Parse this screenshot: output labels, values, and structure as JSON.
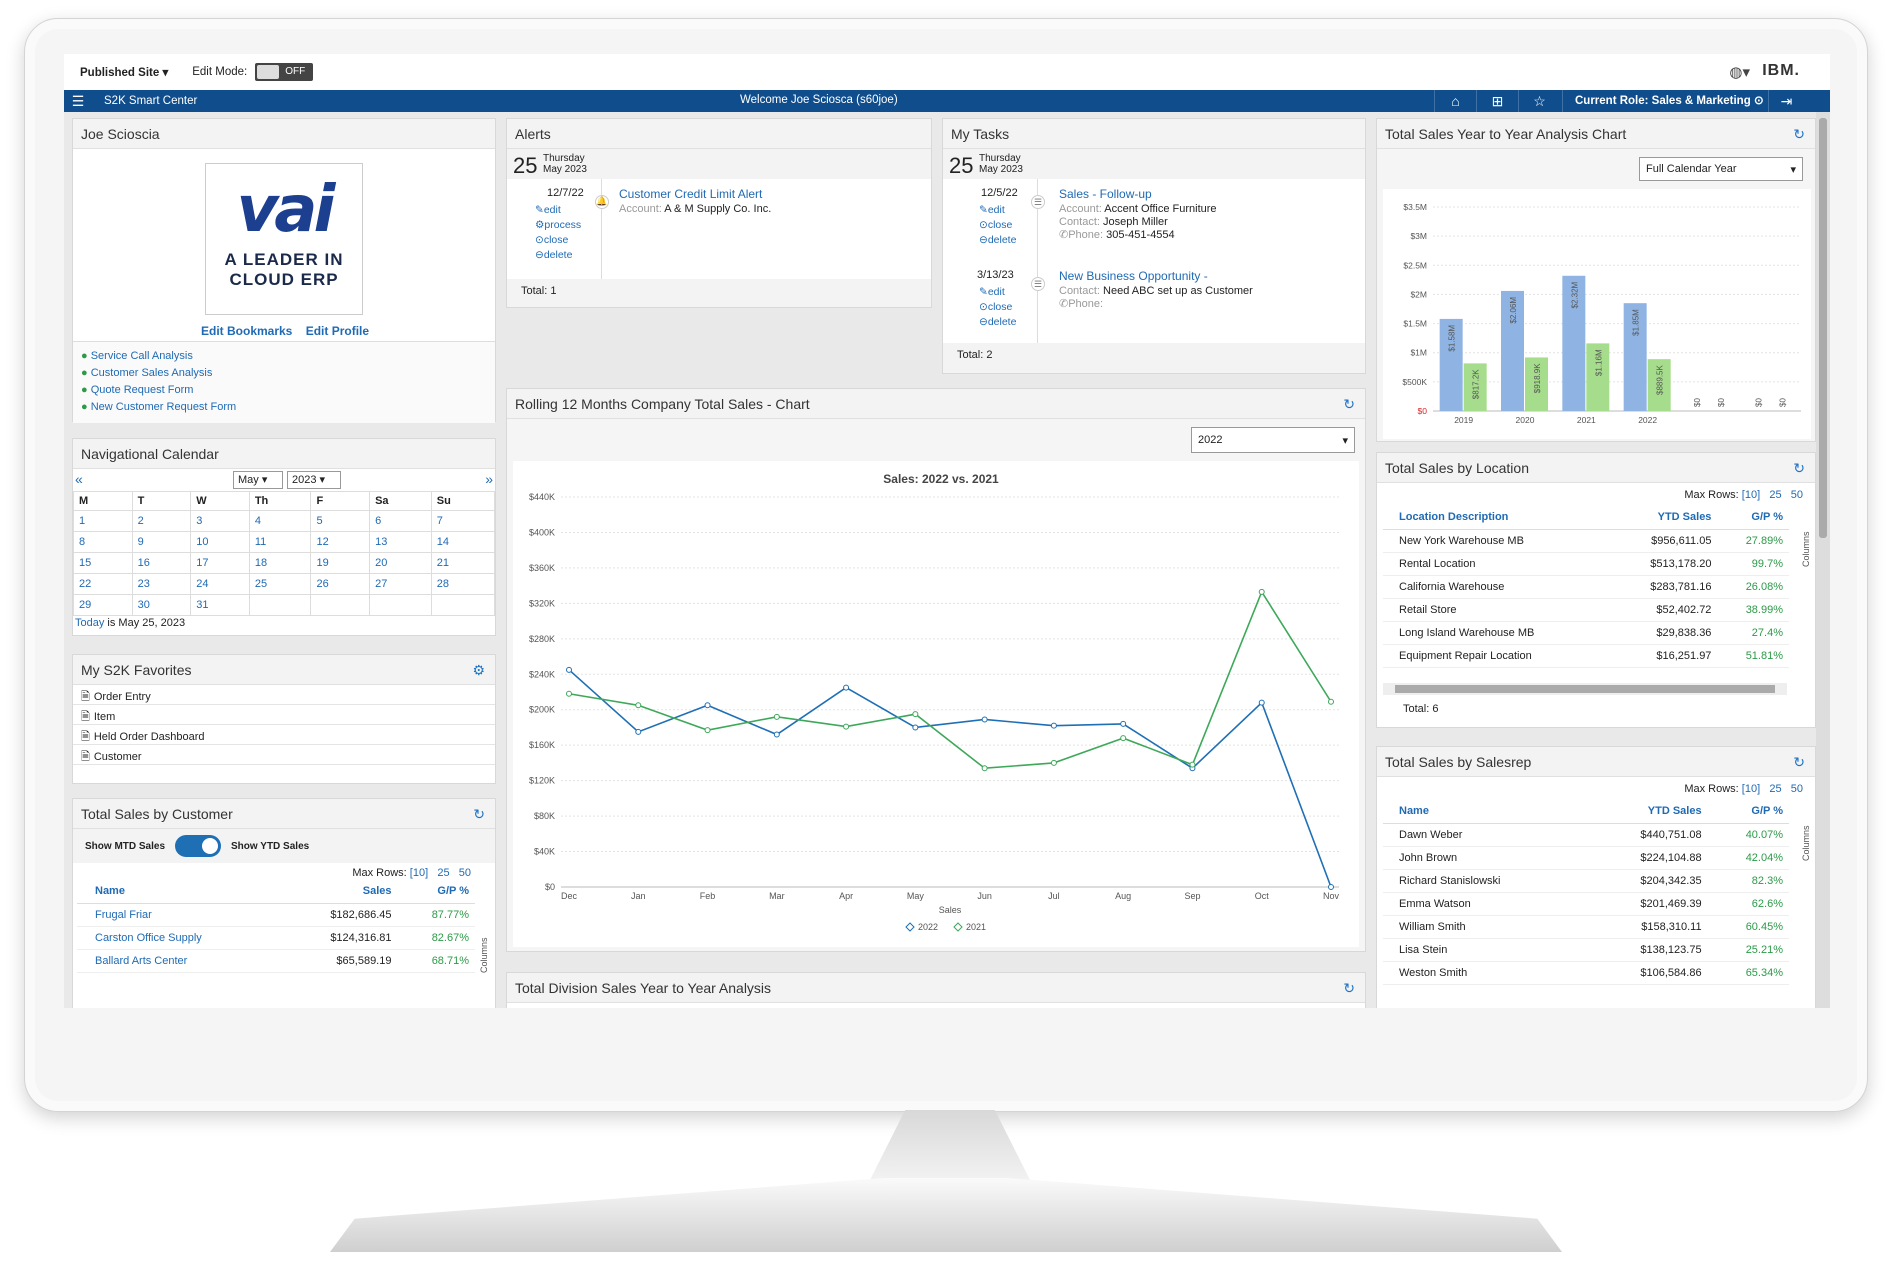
{
  "topbar": {
    "site": "Published Site",
    "edit_mode_label": "Edit Mode:",
    "edit_mode_value": "OFF",
    "brand": "IBM."
  },
  "navbar": {
    "app_title": "S2K Smart Center",
    "welcome": "Welcome Joe Sciosca (s60joe)",
    "role": "Current Role: Sales & Marketing"
  },
  "profile": {
    "name": "Joe Scioscia",
    "logo_text": "vai",
    "logo_tagline_1": "A LEADER IN",
    "logo_tagline_2": "CLOUD ERP",
    "edit_bookmarks": "Edit Bookmarks",
    "edit_profile": "Edit Profile",
    "links": [
      "Service Call Analysis",
      "Customer Sales Analysis",
      "Quote Request Form",
      "New Customer Request Form"
    ]
  },
  "calendar": {
    "title": "Navigational Calendar",
    "month": "May",
    "year": "2023",
    "prev": "«",
    "next": "»",
    "days": [
      "M",
      "T",
      "W",
      "Th",
      "F",
      "Sa",
      "Su"
    ],
    "weeks": [
      [
        "1",
        "2",
        "3",
        "4",
        "5",
        "6",
        "7"
      ],
      [
        "8",
        "9",
        "10",
        "11",
        "12",
        "13",
        "14"
      ],
      [
        "15",
        "16",
        "17",
        "18",
        "19",
        "20",
        "21"
      ],
      [
        "22",
        "23",
        "24",
        "25",
        "26",
        "27",
        "28"
      ],
      [
        "29",
        "30",
        "31",
        "",
        "",
        "",
        ""
      ]
    ],
    "today_link": "Today",
    "today_text": " is May 25, 2023"
  },
  "favorites": {
    "title": "My S2K Favorites",
    "items": [
      "Order Entry",
      "Item",
      "Held Order Dashboard",
      "Customer"
    ]
  },
  "sales_by_customer": {
    "title": "Total Sales by Customer",
    "mtd_label": "Show MTD Sales",
    "ytd_label": "Show YTD Sales",
    "max_rows_label": "Max Rows:",
    "max_rows": [
      "[10]",
      "25",
      "50"
    ],
    "columns_label": "Columns",
    "headers": [
      "Name",
      "Sales",
      "G/P %"
    ],
    "rows": [
      [
        "Frugal Friar",
        "$182,686.45",
        "87.77%"
      ],
      [
        "Carston Office Supply",
        "$124,316.81",
        "82.67%"
      ],
      [
        "Ballard Arts Center",
        "$65,589.19",
        "68.71%"
      ]
    ]
  },
  "alerts": {
    "title": "Alerts",
    "day": "25",
    "weekday": "Thursday",
    "month_year": "May 2023",
    "item": {
      "date": "12/7/22",
      "actions": [
        "edit",
        "process",
        "close",
        "delete"
      ],
      "title": "Customer Credit Limit Alert",
      "account_label": "Account:",
      "account": "A & M Supply Co. Inc."
    },
    "total": "Total: 1"
  },
  "tasks": {
    "title": "My Tasks",
    "day": "25",
    "weekday": "Thursday",
    "month_year": "May 2023",
    "items": [
      {
        "date": "12/5/22",
        "actions": [
          "edit",
          "close",
          "delete"
        ],
        "title": "Sales - Follow-up",
        "account_label": "Account:",
        "account": "Accent Office Furniture",
        "contact_label": "Contact:",
        "contact": "Joseph Miller",
        "phone_label": "Phone:",
        "phone": "305-451-4554"
      },
      {
        "date": "3/13/23",
        "actions": [
          "edit",
          "close",
          "delete"
        ],
        "title": "New Business Opportunity -",
        "contact_label": "Contact:",
        "contact": "Need ABC set up as Customer",
        "phone_label": "Phone:",
        "phone": ""
      }
    ],
    "total": "Total: 2"
  },
  "rolling_chart": {
    "title": "Rolling 12 Months Company Total Sales - Chart",
    "year_select": "2022",
    "chart_title": "Sales: 2022 vs. 2021"
  },
  "division_panel": {
    "title": "Total Division Sales Year to Year Analysis"
  },
  "yoy_chart": {
    "title": "Total Sales Year to Year Analysis Chart",
    "select": "Full Calendar Year"
  },
  "sales_by_location": {
    "title": "Total Sales by Location",
    "max_rows_label": "Max Rows:",
    "max_rows": [
      "[10]",
      "25",
      "50"
    ],
    "columns_label": "Columns",
    "headers": [
      "Location Description",
      "YTD Sales",
      "G/P %"
    ],
    "rows": [
      [
        "New York Warehouse MB",
        "$956,611.05",
        "27.89%"
      ],
      [
        "Rental Location",
        "$513,178.20",
        "99.7%"
      ],
      [
        "California Warehouse",
        "$283,781.16",
        "26.08%"
      ],
      [
        "Retail Store",
        "$52,402.72",
        "38.99%"
      ],
      [
        "Long Island Warehouse MB",
        "$29,838.36",
        "27.4%"
      ],
      [
        "Equipment Repair Location",
        "$16,251.97",
        "51.81%"
      ]
    ],
    "total": "Total: 6"
  },
  "sales_by_salesrep": {
    "title": "Total Sales by Salesrep",
    "max_rows_label": "Max Rows:",
    "max_rows": [
      "[10]",
      "25",
      "50"
    ],
    "columns_label": "Columns",
    "headers": [
      "Name",
      "YTD Sales",
      "G/P %"
    ],
    "rows": [
      [
        "Dawn Weber",
        "$440,751.08",
        "40.07%"
      ],
      [
        "John Brown",
        "$224,104.88",
        "42.04%"
      ],
      [
        "Richard Stanislowski",
        "$204,342.35",
        "82.3%"
      ],
      [
        "Emma Watson",
        "$201,469.39",
        "62.6%"
      ],
      [
        "William Smith",
        "$158,310.11",
        "60.45%"
      ],
      [
        "Lisa Stein",
        "$138,123.75",
        "25.21%"
      ],
      [
        "Weston Smith",
        "$106,584.86",
        "65.34%"
      ]
    ]
  },
  "colors": {
    "nav": "#0f4d8c",
    "series_2022": "#1f6fb5",
    "series_2021": "#3ea85a",
    "bar_blue": "#8fb4e3",
    "bar_green": "#a6dd8c"
  },
  "chart_data": [
    {
      "type": "line",
      "title": "Sales: 2022 vs. 2021",
      "xlabel": "Sales",
      "ylabel": "",
      "categories": [
        "Dec",
        "Jan",
        "Feb",
        "Mar",
        "Apr",
        "May",
        "Jun",
        "Jul",
        "Aug",
        "Sep",
        "Oct",
        "Nov"
      ],
      "y_ticks": [
        "$0",
        "$40K",
        "$80K",
        "$120K",
        "$160K",
        "$200K",
        "$240K",
        "$280K",
        "$320K",
        "$360K",
        "$400K",
        "$440K"
      ],
      "ylim": [
        0,
        440000
      ],
      "grid": true,
      "legend": "bottom",
      "series": [
        {
          "name": "2022",
          "values": [
            245000,
            175000,
            205000,
            172000,
            225000,
            180000,
            189000,
            182000,
            184000,
            134000,
            208000,
            0
          ]
        },
        {
          "name": "2021",
          "values": [
            218000,
            205000,
            177000,
            192000,
            181000,
            195000,
            134000,
            140000,
            168000,
            138000,
            333000,
            209000
          ]
        }
      ]
    },
    {
      "type": "bar",
      "title": "",
      "categories": [
        "2019",
        "2020",
        "2021",
        "2022",
        "",
        ""
      ],
      "y_ticks": [
        "$0",
        "$500K",
        "$1M",
        "$1.5M",
        "$2M",
        "$2.5M",
        "$3M",
        "$3.5M"
      ],
      "ylim": [
        0,
        3500000
      ],
      "grid": true,
      "series": [
        {
          "values": [
            1580000,
            2060000,
            2320000,
            1850000,
            0,
            0
          ],
          "labels": [
            "$1.58M",
            "$2.06M",
            "$2.32M",
            "$1.85M",
            "$0",
            "$0"
          ]
        },
        {
          "values": [
            817200,
            918900,
            1160000,
            889500,
            0,
            0
          ],
          "labels": [
            "$817.2K",
            "$918.9K",
            "$1.16M",
            "$889.5K",
            "$0",
            "$0"
          ]
        }
      ]
    }
  ]
}
